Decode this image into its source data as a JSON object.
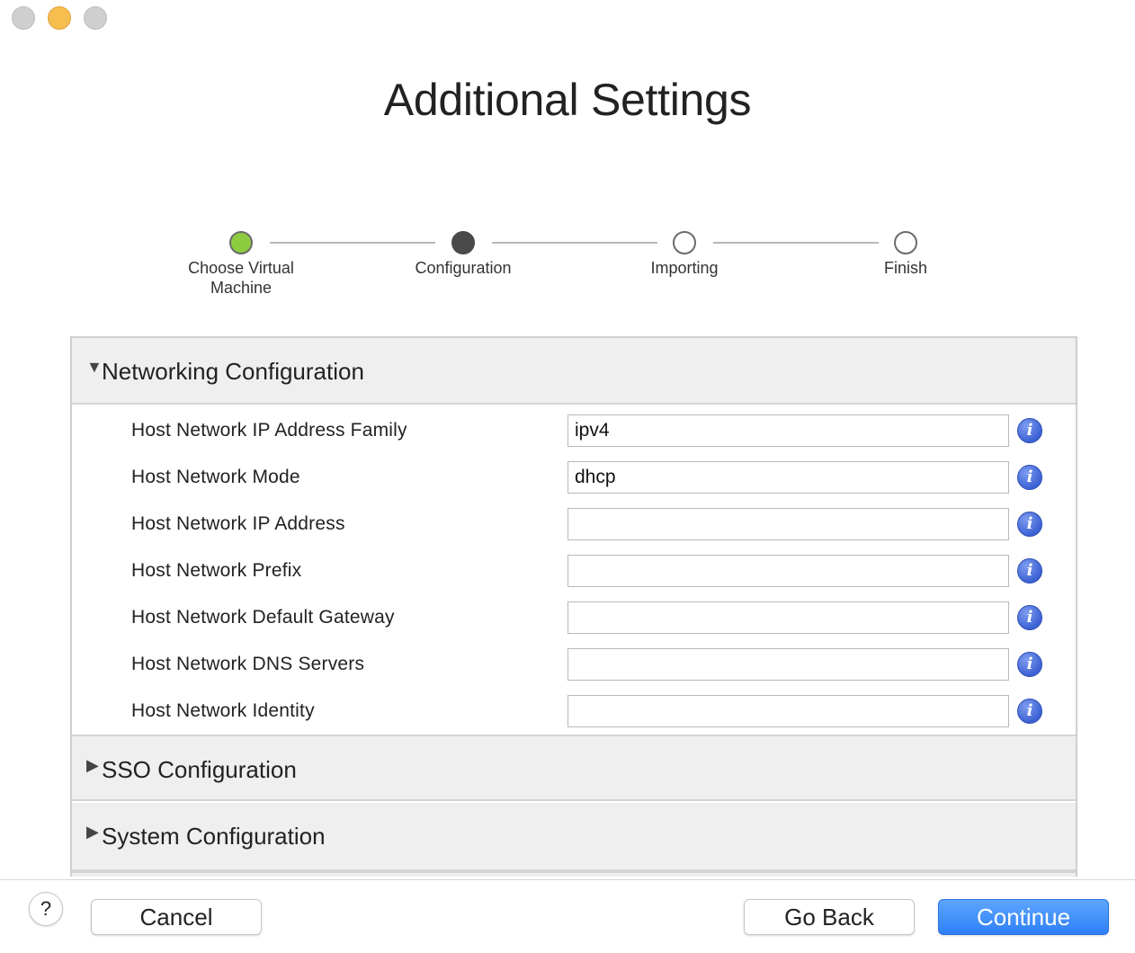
{
  "window": {
    "title": "Additional Settings"
  },
  "steps": [
    {
      "label": "Choose Virtual\nMachine",
      "state": "done"
    },
    {
      "label": "Configuration",
      "state": "current"
    },
    {
      "label": "Importing",
      "state": "todo"
    },
    {
      "label": "Finish",
      "state": "todo"
    }
  ],
  "sections": {
    "networking": {
      "title": "Networking Configuration",
      "expanded": true
    },
    "sso": {
      "title": "SSO Configuration",
      "expanded": false
    },
    "system": {
      "title": "System Configuration",
      "expanded": false
    }
  },
  "fields": [
    {
      "label": "Host Network IP Address Family",
      "value": "ipv4"
    },
    {
      "label": "Host Network Mode",
      "value": "dhcp"
    },
    {
      "label": "Host Network IP Address",
      "value": ""
    },
    {
      "label": "Host Network Prefix",
      "value": ""
    },
    {
      "label": "Host Network Default Gateway",
      "value": ""
    },
    {
      "label": "Host Network DNS Servers",
      "value": ""
    },
    {
      "label": "Host Network Identity",
      "value": ""
    }
  ],
  "icons": {
    "expanded": "▼",
    "collapsed": "▶",
    "info": "i",
    "help": "?"
  },
  "footer": {
    "cancel_label": "Cancel",
    "back_label": "Go Back",
    "continue_label": "Continue"
  },
  "colors": {
    "step_done": "#8dcc3f",
    "step_current": "#4a4a4a",
    "primary_button": "#2d7ff7",
    "info_icon": "#3c62d4"
  }
}
